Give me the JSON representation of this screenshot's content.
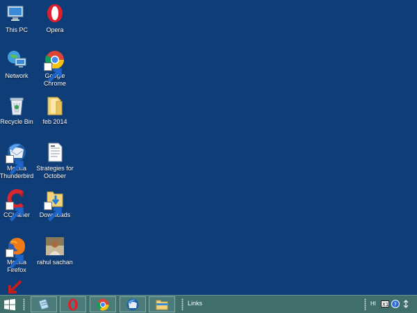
{
  "desktop": {
    "background_color": "#0f3d78",
    "icons": [
      {
        "label": "This PC",
        "icon": "computer-icon"
      },
      {
        "label": "Opera",
        "icon": "opera-icon"
      },
      {
        "label": "Network",
        "icon": "network-icon"
      },
      {
        "label": "Google Chrome",
        "icon": "chrome-icon"
      },
      {
        "label": "Recycle Bin",
        "icon": "recycle-bin-icon"
      },
      {
        "label": "feb 2014",
        "icon": "folder-icon"
      },
      {
        "label": "Mozilla Thunderbird",
        "icon": "thunderbird-icon"
      },
      {
        "label": "Strategies for October",
        "icon": "document-icon"
      },
      {
        "label": "CCleaner",
        "icon": "ccleaner-icon"
      },
      {
        "label": "Downloads",
        "icon": "downloads-folder-icon"
      },
      {
        "label": "Mozilla Firefox",
        "icon": "firefox-icon"
      },
      {
        "label": "rahul sachan",
        "icon": "user-photo-icon"
      }
    ]
  },
  "taskbar": {
    "background_color": "#3f6e6b",
    "start_icon": "windows-logo-icon",
    "pinned": [
      {
        "icon": "notepad-icon"
      },
      {
        "icon": "opera-icon"
      },
      {
        "icon": "chrome-icon"
      },
      {
        "icon": "thunderbird-icon"
      },
      {
        "icon": "file-explorer-icon"
      }
    ],
    "toolbar_label": "Links",
    "tray": {
      "language": "HI",
      "icons": [
        "keyboard-icon",
        "help-icon",
        "network-tray-icon"
      ]
    }
  }
}
